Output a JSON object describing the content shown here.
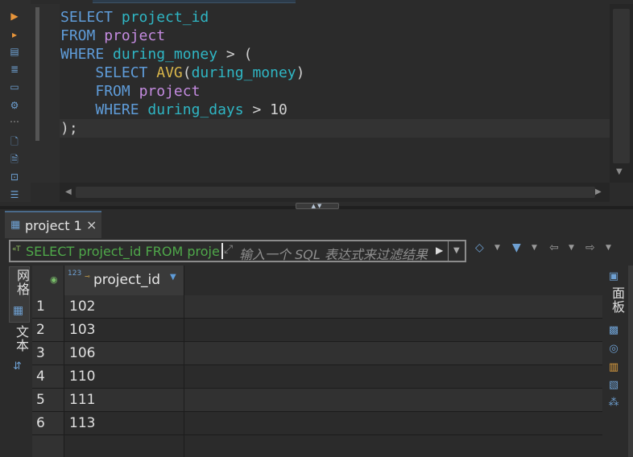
{
  "editor": {
    "lines": [
      [
        {
          "t": "SELECT",
          "c": "kw"
        },
        {
          "t": " ",
          "c": "op"
        },
        {
          "t": "project_id",
          "c": "id"
        }
      ],
      [
        {
          "t": "FROM",
          "c": "kw"
        },
        {
          "t": " ",
          "c": "op"
        },
        {
          "t": "project",
          "c": "tb"
        }
      ],
      [
        {
          "t": "WHERE",
          "c": "kw"
        },
        {
          "t": " ",
          "c": "op"
        },
        {
          "t": "during_money",
          "c": "id"
        },
        {
          "t": " > (",
          "c": "op"
        }
      ],
      [
        {
          "t": "    ",
          "c": "op"
        },
        {
          "t": "SELECT",
          "c": "kw"
        },
        {
          "t": " ",
          "c": "op"
        },
        {
          "t": "AVG",
          "c": "fn"
        },
        {
          "t": "(",
          "c": "op"
        },
        {
          "t": "during_money",
          "c": "id"
        },
        {
          "t": ")",
          "c": "op"
        }
      ],
      [
        {
          "t": "    ",
          "c": "op"
        },
        {
          "t": "FROM",
          "c": "kw"
        },
        {
          "t": " ",
          "c": "op"
        },
        {
          "t": "project",
          "c": "tb"
        }
      ],
      [
        {
          "t": "    ",
          "c": "op"
        },
        {
          "t": "WHERE",
          "c": "kw"
        },
        {
          "t": " ",
          "c": "op"
        },
        {
          "t": "during_days",
          "c": "id"
        },
        {
          "t": " > ",
          "c": "op"
        },
        {
          "t": "10",
          "c": "nm"
        }
      ],
      [
        {
          "t": ");",
          "c": "op"
        }
      ]
    ]
  },
  "results_tab": {
    "label": "project 1",
    "close": "×",
    "icon": "table-icon"
  },
  "filter": {
    "sql_text": "SELECT project_id FROM project",
    "placeholder": "输入一个 SQL 表达式来过滤结果"
  },
  "side_tabs": {
    "grid_label": "网格",
    "text_label": "文本"
  },
  "right_panel": {
    "label": "面板"
  },
  "grid": {
    "column": "project_id",
    "type_badge": "123",
    "rows": [
      {
        "num": "1",
        "value": "102"
      },
      {
        "num": "2",
        "value": "103"
      },
      {
        "num": "3",
        "value": "106"
      },
      {
        "num": "4",
        "value": "110"
      },
      {
        "num": "5",
        "value": "111"
      },
      {
        "num": "6",
        "value": "113"
      }
    ]
  },
  "colors": {
    "keyword": "#5f9cd9",
    "identifier": "#2fb6c4",
    "table": "#c48be0",
    "function": "#d9b64a",
    "filter_sql": "#4fa84a"
  }
}
